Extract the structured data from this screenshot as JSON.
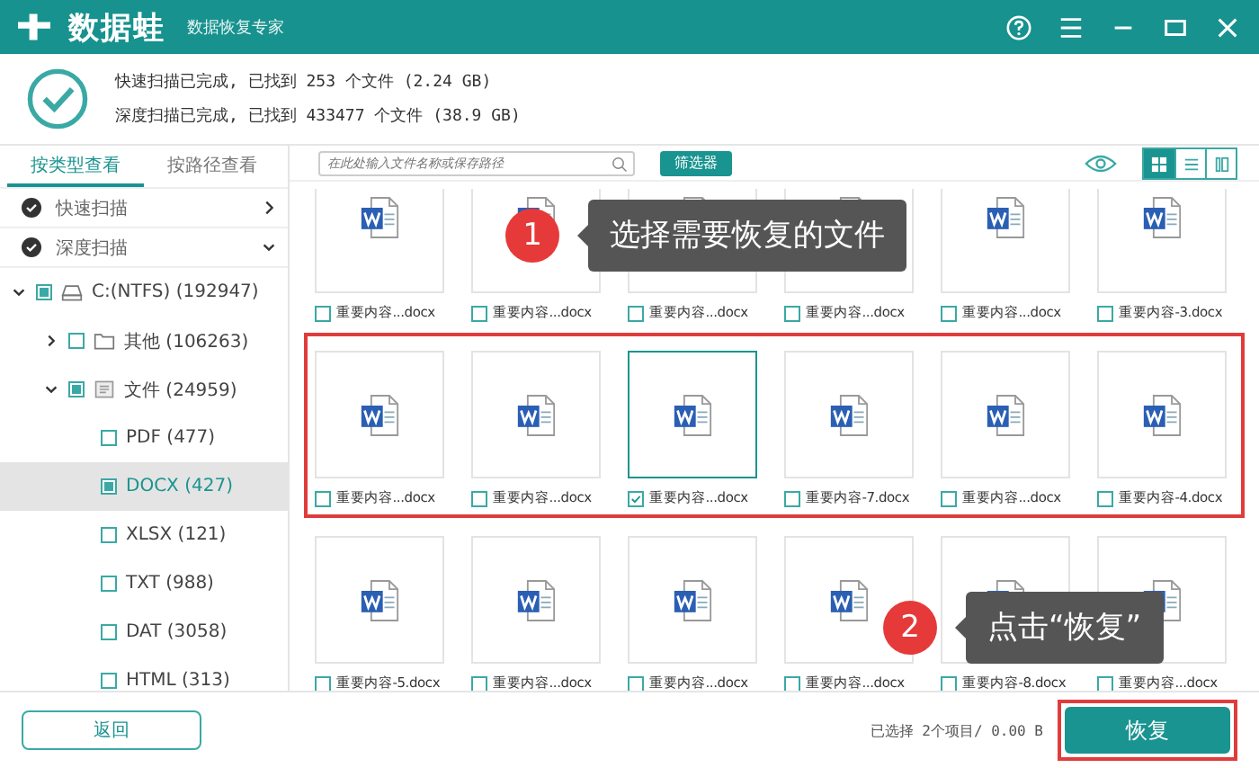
{
  "app": {
    "logo": "数据蛙",
    "subtitle": "数据恢复专家"
  },
  "scan_summary": [
    "快速扫描已完成, 已找到 253 个文件 (2.24 GB)",
    "深度扫描已完成, 已找到 433477 个文件 (38.9 GB)"
  ],
  "view_tabs": [
    {
      "label": "按类型查看",
      "selected": true
    },
    {
      "label": "按路径查看",
      "selected": false
    }
  ],
  "scans": [
    {
      "label": "快速扫描",
      "expanded": false
    },
    {
      "label": "深度扫描",
      "expanded": true
    }
  ],
  "tree": [
    {
      "label": "C:(NTFS) (192947)",
      "kind": "drive",
      "checked": true,
      "expanded": true,
      "selected": false,
      "children": [
        {
          "label": "其他 (106263)",
          "kind": "folder",
          "checked": false,
          "expanded": false,
          "selected": false
        },
        {
          "label": "文件 (24959)",
          "kind": "filegroup",
          "checked": true,
          "expanded": true,
          "selected": false,
          "children": [
            {
              "label": "PDF (477)",
              "checked": false,
              "selected": false
            },
            {
              "label": "DOCX (427)",
              "checked": true,
              "selected": true
            },
            {
              "label": "XLSX (121)",
              "checked": false,
              "selected": false
            },
            {
              "label": "TXT (988)",
              "checked": false,
              "selected": false
            },
            {
              "label": "DAT (3058)",
              "checked": false,
              "selected": false
            },
            {
              "label": "HTML (313)",
              "checked": false,
              "selected": false
            }
          ]
        }
      ]
    }
  ],
  "search": {
    "placeholder": "在此处输入文件名称或保存路径"
  },
  "filter_button": "筛选器",
  "view_modes": [
    {
      "kind": "grid",
      "selected": true
    },
    {
      "kind": "list",
      "selected": false
    },
    {
      "kind": "detail",
      "selected": false
    }
  ],
  "file_rows": [
    {
      "highlighted": false,
      "files": [
        {
          "name": "重要内容...docx",
          "checked": false,
          "selected": false
        },
        {
          "name": "重要内容...docx",
          "checked": false,
          "selected": false
        },
        {
          "name": "重要内容...docx",
          "checked": false,
          "selected": false
        },
        {
          "name": "重要内容...docx",
          "checked": false,
          "selected": false
        },
        {
          "name": "重要内容...docx",
          "checked": false,
          "selected": false
        },
        {
          "name": "重要内容-3.docx",
          "checked": false,
          "selected": false
        }
      ]
    },
    {
      "highlighted": true,
      "files": [
        {
          "name": "重要内容...docx",
          "checked": false,
          "selected": false
        },
        {
          "name": "重要内容...docx",
          "checked": false,
          "selected": false
        },
        {
          "name": "重要内容...docx",
          "checked": true,
          "selected": true
        },
        {
          "name": "重要内容-7.docx",
          "checked": false,
          "selected": false
        },
        {
          "name": "重要内容...docx",
          "checked": false,
          "selected": false
        },
        {
          "name": "重要内容-4.docx",
          "checked": false,
          "selected": false
        }
      ]
    },
    {
      "highlighted": false,
      "files": [
        {
          "name": "重要内容-5.docx",
          "checked": false,
          "selected": false
        },
        {
          "name": "重要内容...docx",
          "checked": false,
          "selected": false
        },
        {
          "name": "重要内容...docx",
          "checked": false,
          "selected": false
        },
        {
          "name": "重要内容...docx",
          "checked": false,
          "selected": false
        },
        {
          "name": "重要内容-8.docx",
          "checked": false,
          "selected": false
        },
        {
          "name": "重要内容...docx",
          "checked": false,
          "selected": false
        }
      ]
    }
  ],
  "callouts": [
    {
      "number": "1",
      "text": "选择需要恢复的文件"
    },
    {
      "number": "2",
      "text": "点击“恢复”"
    }
  ],
  "back_button": "返回",
  "selection_status": "已选择 2个项目/ 0.00 B",
  "recover_button": {
    "label": "恢复",
    "highlighted": true
  }
}
